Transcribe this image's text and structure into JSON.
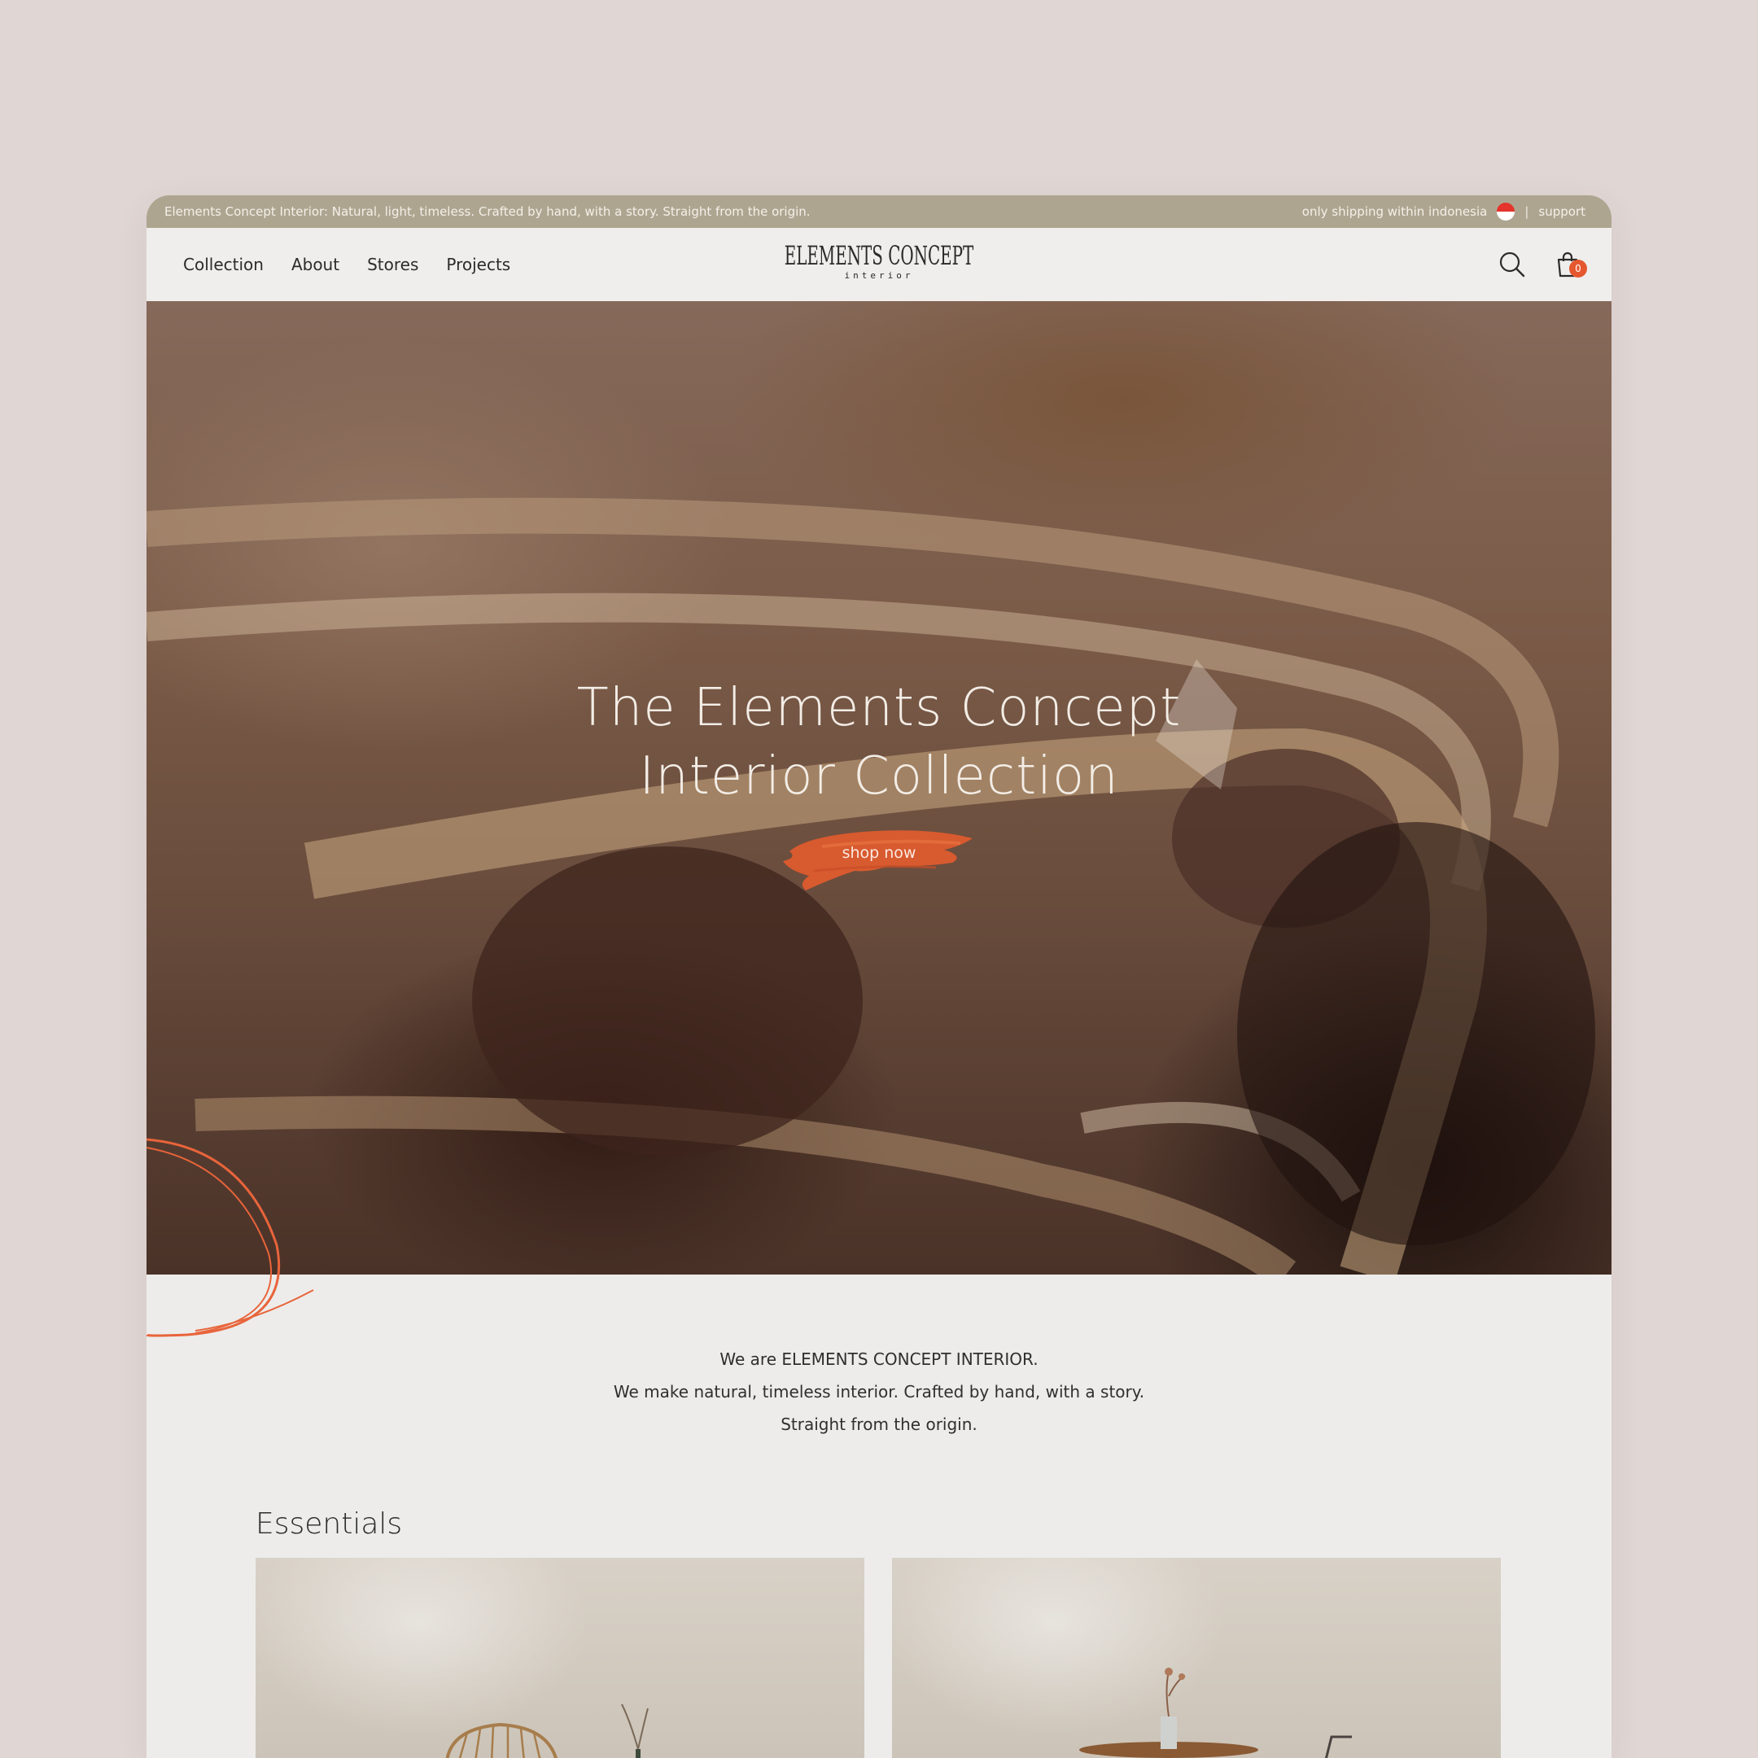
{
  "announcement": {
    "text": "Elements Concept Interior: Natural, light, timeless. Crafted by hand, with a story. Straight from the origin.",
    "shipping": "only shipping within indonesia",
    "separator": "|",
    "support": "support"
  },
  "nav": {
    "items": [
      {
        "label": "Collection"
      },
      {
        "label": "About"
      },
      {
        "label": "Stores"
      },
      {
        "label": "Projects"
      }
    ]
  },
  "logo": {
    "main": "ELEMENTS CONCEPT",
    "sub": "interior"
  },
  "header_icons": {
    "search": "search-icon",
    "cart": "shopping-bag-icon",
    "cart_count": "0"
  },
  "hero": {
    "title_line1": "The Elements Concept",
    "title_line2": "Interior Collection",
    "cta": "shop now"
  },
  "intro": {
    "line1": "We are ELEMENTS CONCEPT INTERIOR.",
    "line2": "We make natural, timeless interior. Crafted by hand, with a story.",
    "line3": "Straight from the origin."
  },
  "essentials": {
    "title": "Essentials"
  },
  "colors": {
    "page_bg": "#e0d6d4",
    "announce_bg": "#aea591",
    "accent": "#e5572f",
    "content_bg": "#edecea"
  }
}
